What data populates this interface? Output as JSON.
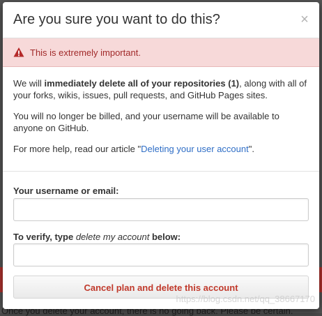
{
  "background": {
    "behind_text": "Once you delete your account, there is no going back. Please be certain."
  },
  "modal": {
    "title": "Are you sure you want to do this?",
    "close_glyph": "×",
    "flash": {
      "text": "This is extremely important.",
      "icon": "warning-icon",
      "color": "#a12a2a",
      "background": "#f7d9d9"
    },
    "body": {
      "p1_prefix": "We will ",
      "p1_bold": "immediately delete all of your repositories (1)",
      "p1_suffix": ", along with all of your forks, wikis, issues, pull requests, and GitHub Pages sites.",
      "p2": "You will no longer be billed, and your username will be available to anyone on GitHub.",
      "p3_prefix": "For more help, read our article \"",
      "p3_link": "Deleting your user account",
      "p3_suffix": "\"."
    },
    "form": {
      "username_label": "Your username or email:",
      "username_value": "",
      "verify_label_prefix": "To verify, type ",
      "verify_label_phrase": "delete my account",
      "verify_label_suffix": " below:",
      "verify_value": "",
      "submit_label": "Cancel plan and delete this account"
    }
  },
  "watermark": "https://blog.csdn.net/qq_38667170",
  "colors": {
    "link": "#2f6ec6",
    "danger": "#c0392b"
  }
}
